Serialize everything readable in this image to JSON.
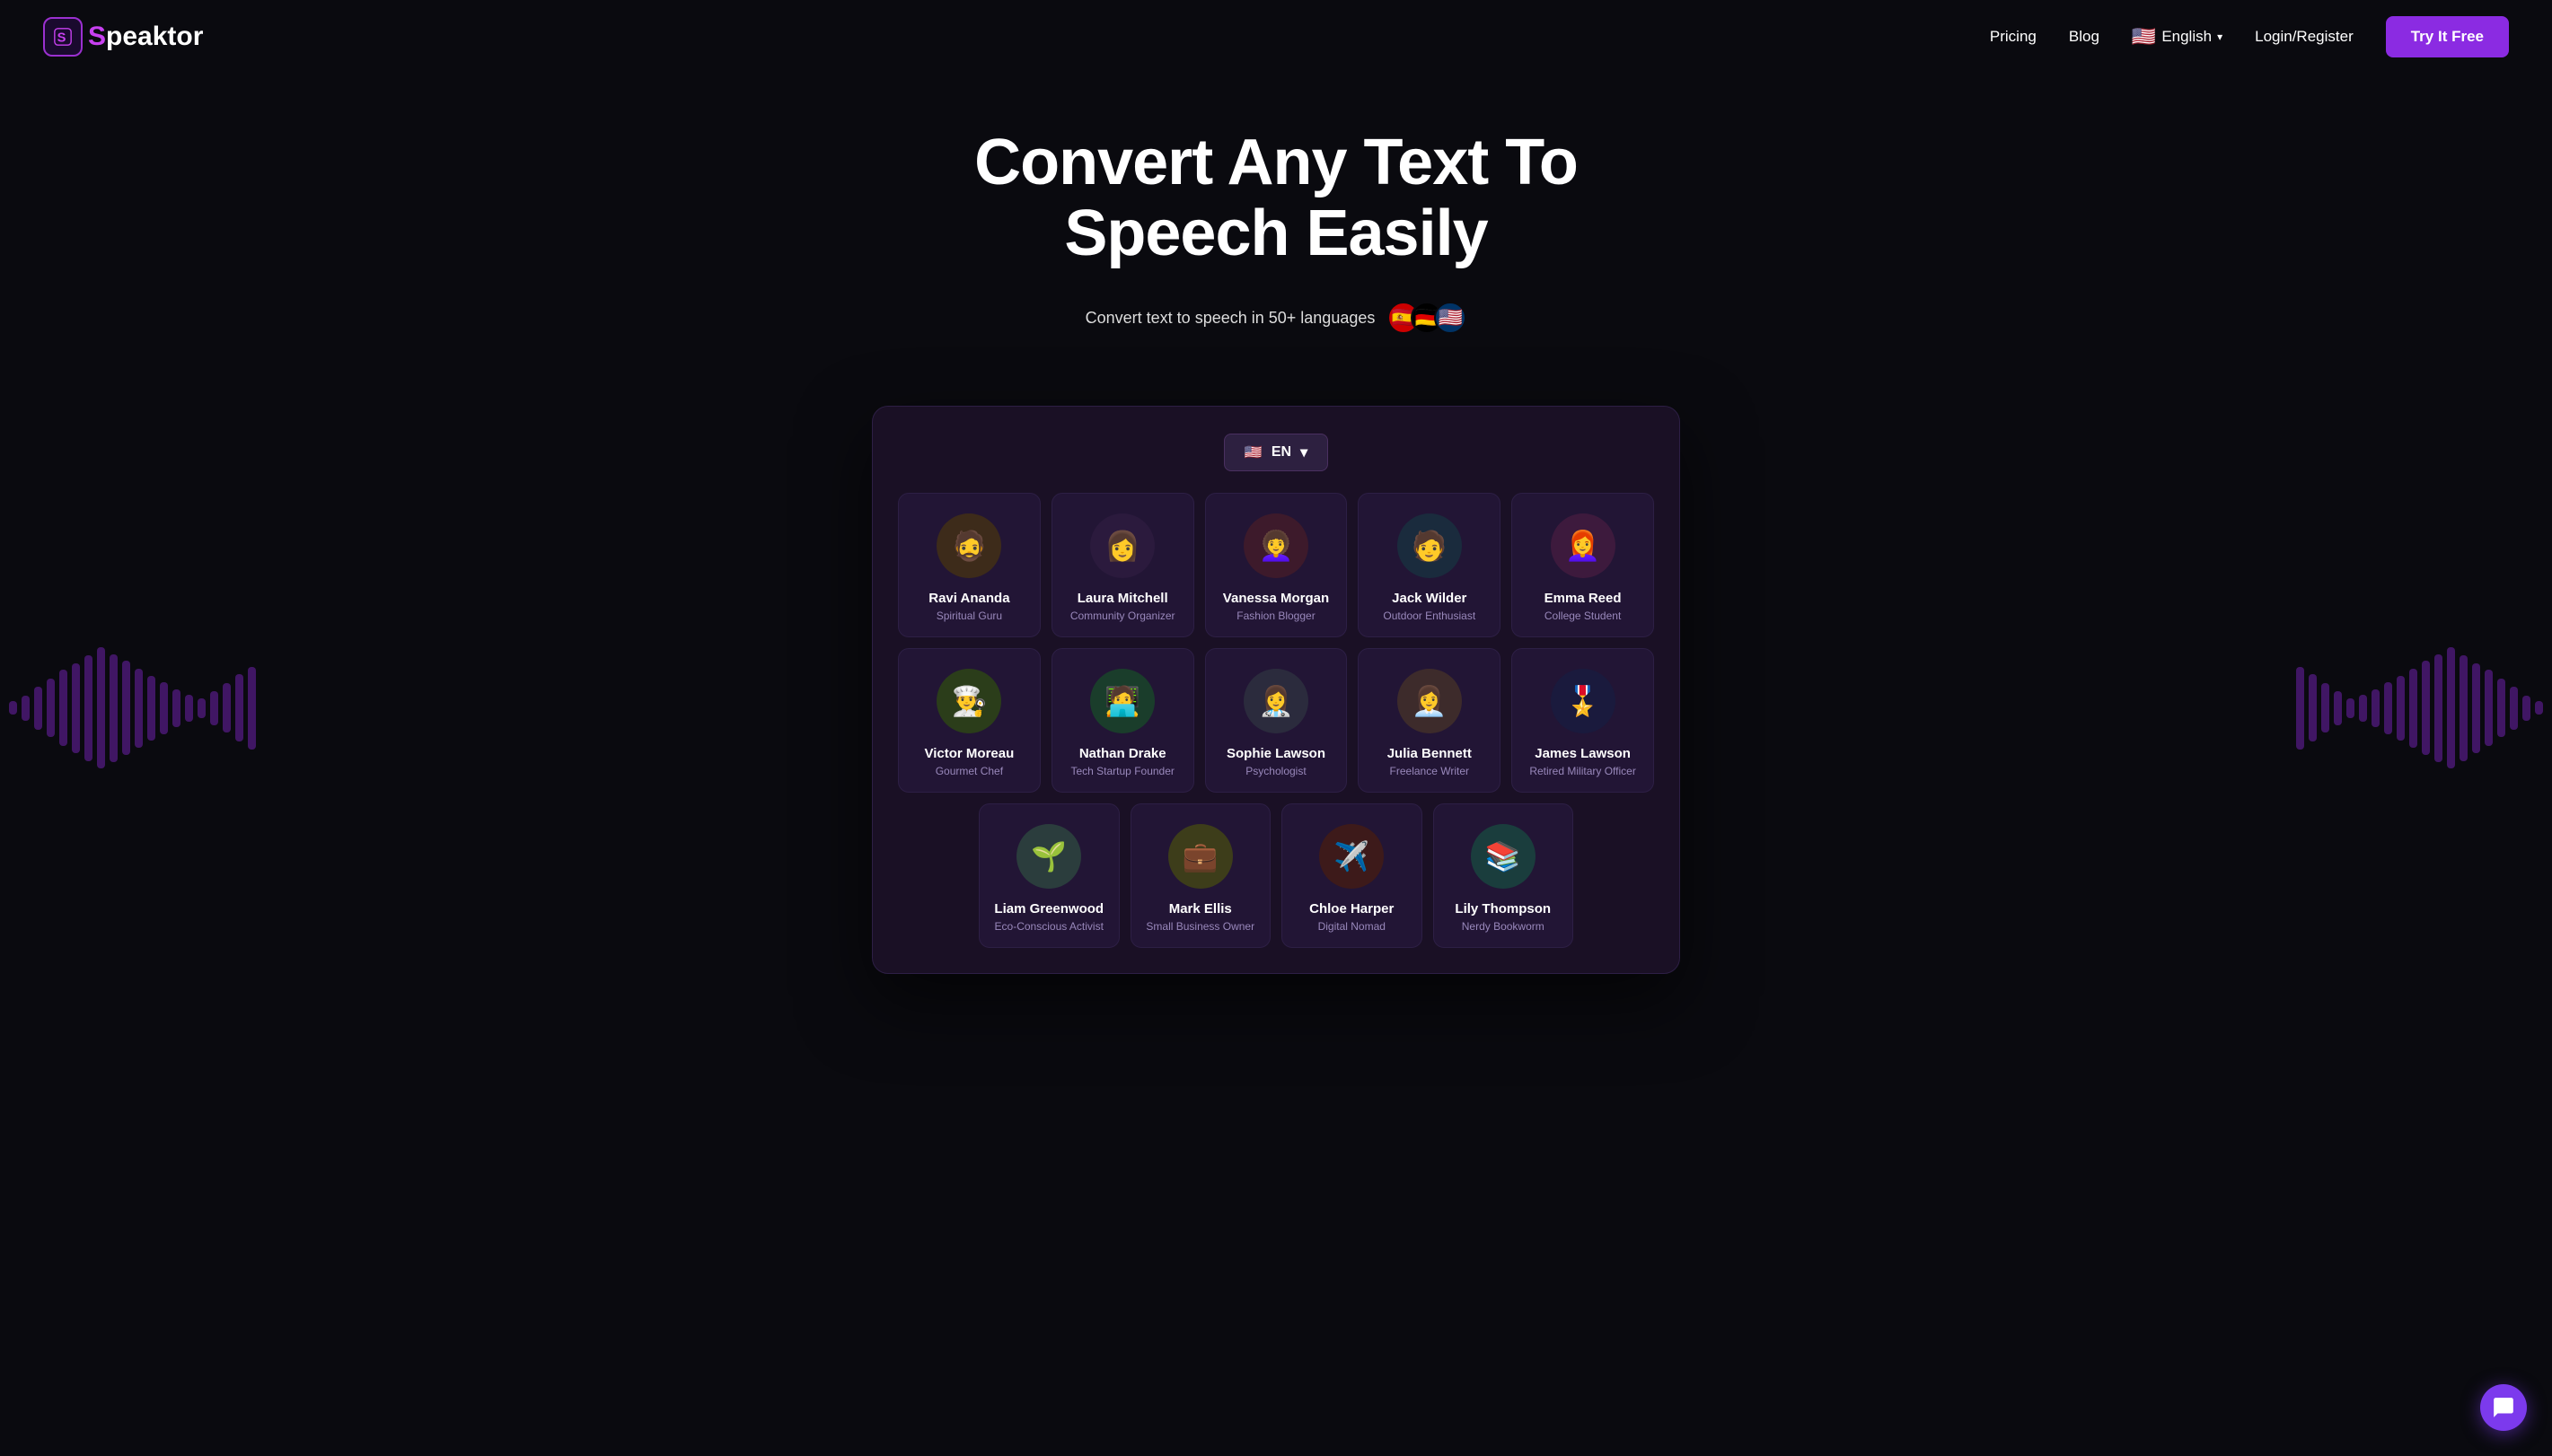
{
  "nav": {
    "logo_letter": "S",
    "logo_name_before": "",
    "logo_full": "Speaktor",
    "pricing": "Pricing",
    "blog": "Blog",
    "language": "English",
    "login": "Login/Register",
    "try_free": "Try It Free"
  },
  "hero": {
    "headline": "Convert Any Text To Speech Easily",
    "subtext": "Convert text to speech in 50+ languages"
  },
  "app": {
    "lang_code": "EN",
    "voices_row1": [
      {
        "name": "Ravi Ananda",
        "role": "Spiritual Guru",
        "emoji": "🧔"
      },
      {
        "name": "Laura Mitchell",
        "role": "Community Organizer",
        "emoji": "👩"
      },
      {
        "name": "Vanessa Morgan",
        "role": "Fashion Blogger",
        "emoji": "👩‍🦱"
      },
      {
        "name": "Jack Wilder",
        "role": "Outdoor Enthusiast",
        "emoji": "🧑"
      },
      {
        "name": "Emma Reed",
        "role": "College Student",
        "emoji": "👩‍🦰"
      }
    ],
    "voices_row2": [
      {
        "name": "Victor Moreau",
        "role": "Gourmet Chef",
        "emoji": "👨‍🍳"
      },
      {
        "name": "Nathan Drake",
        "role": "Tech Startup Founder",
        "emoji": "🧑‍💻"
      },
      {
        "name": "Sophie Lawson",
        "role": "Psychologist",
        "emoji": "👩‍⚕️"
      },
      {
        "name": "Julia Bennett",
        "role": "Freelance Writer",
        "emoji": "👩‍💼"
      },
      {
        "name": "James Lawson",
        "role": "Retired Military Officer",
        "emoji": "🎖️"
      }
    ],
    "voices_row3": [
      {
        "name": "Liam Greenwood",
        "role": "Eco-Conscious Activist",
        "emoji": "🌱"
      },
      {
        "name": "Mark Ellis",
        "role": "Small Business Owner",
        "emoji": "💼"
      },
      {
        "name": "Chloe Harper",
        "role": "Digital Nomad",
        "emoji": "✈️"
      },
      {
        "name": "Lily Thompson",
        "role": "Nerdy Bookworm",
        "emoji": "📚"
      }
    ]
  },
  "waveform": {
    "left_bars": [
      12,
      28,
      45,
      60,
      80,
      95,
      110,
      130,
      115,
      100,
      85,
      70,
      55,
      40,
      30,
      20,
      35,
      50,
      70,
      90
    ],
    "right_bars": [
      90,
      70,
      50,
      35,
      20,
      30,
      40,
      55,
      70,
      85,
      100,
      115,
      130,
      110,
      95,
      80,
      60,
      45,
      28,
      12
    ]
  }
}
